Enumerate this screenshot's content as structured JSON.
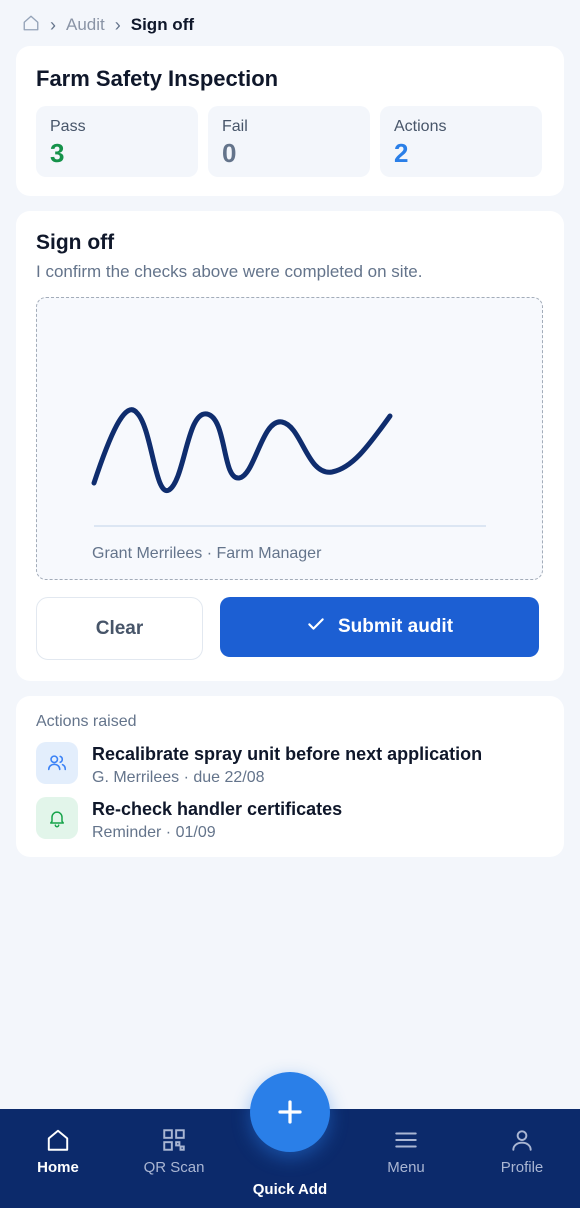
{
  "breadcrumb": {
    "parent": "Audit",
    "current": "Sign off"
  },
  "inspection": {
    "title": "Farm Safety Inspection",
    "stats": [
      {
        "label": "Pass",
        "value": "3",
        "color": "#15924a"
      },
      {
        "label": "Fail",
        "value": "0",
        "color": "#64748b"
      },
      {
        "label": "Actions",
        "value": "2",
        "color": "#2a7fe8"
      }
    ]
  },
  "signoff": {
    "title": "Sign off",
    "description": "I confirm the checks above were completed on site.",
    "signer": "Grant Merrilees · Farm Manager",
    "clear_label": "Clear",
    "submit_label": "Submit audit",
    "signature_color": "#0f2d6e",
    "accent": "#1c5fd3"
  },
  "actions": {
    "heading": "Actions raised",
    "items": [
      {
        "title": "Recalibrate spray unit before next application",
        "subtitle": "G. Merrilees · due 22/08",
        "icon": "users-icon"
      },
      {
        "title": "Re-check handler certificates",
        "subtitle": "Reminder · 01/09",
        "icon": "bell-icon"
      }
    ]
  },
  "nav": {
    "items": [
      {
        "label": "Home",
        "icon": "home-icon",
        "active": true
      },
      {
        "label": "QR Scan",
        "icon": "qr-icon",
        "active": false
      },
      {
        "label": "Menu",
        "icon": "menu-icon",
        "active": false
      },
      {
        "label": "Profile",
        "icon": "profile-icon",
        "active": false
      }
    ],
    "quick_add_label": "Quick Add",
    "background": "#0c2a6b"
  }
}
